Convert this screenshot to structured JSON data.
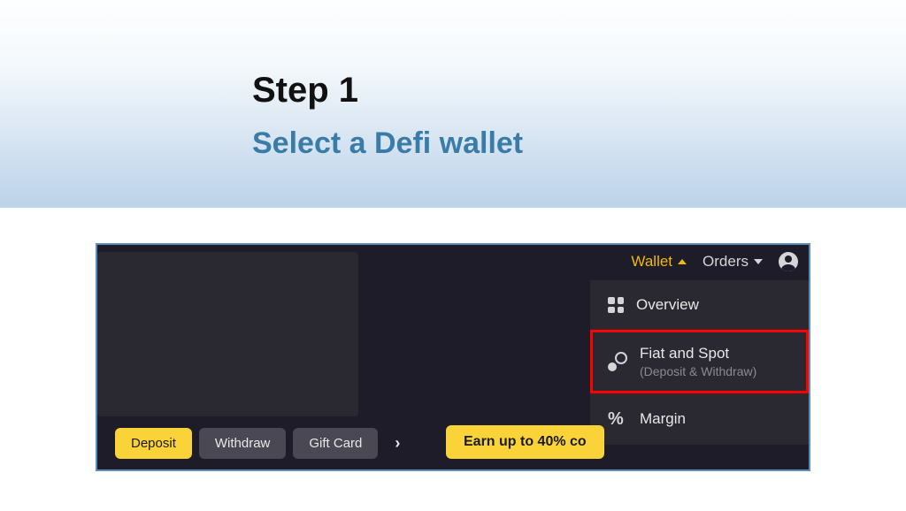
{
  "header": {
    "step_title": "Step 1",
    "step_subtitle": "Select a Defi wallet"
  },
  "nav": {
    "wallet_label": "Wallet",
    "orders_label": "Orders"
  },
  "dropdown": {
    "overview": "Overview",
    "fiat_spot": {
      "title": "Fiat and Spot",
      "subtitle": "(Deposit & Withdraw)"
    },
    "margin": "Margin"
  },
  "buttons": {
    "deposit": "Deposit",
    "withdraw": "Withdraw",
    "gift_card": "Gift Card"
  },
  "promo": {
    "text": "Earn up to 40% co"
  }
}
